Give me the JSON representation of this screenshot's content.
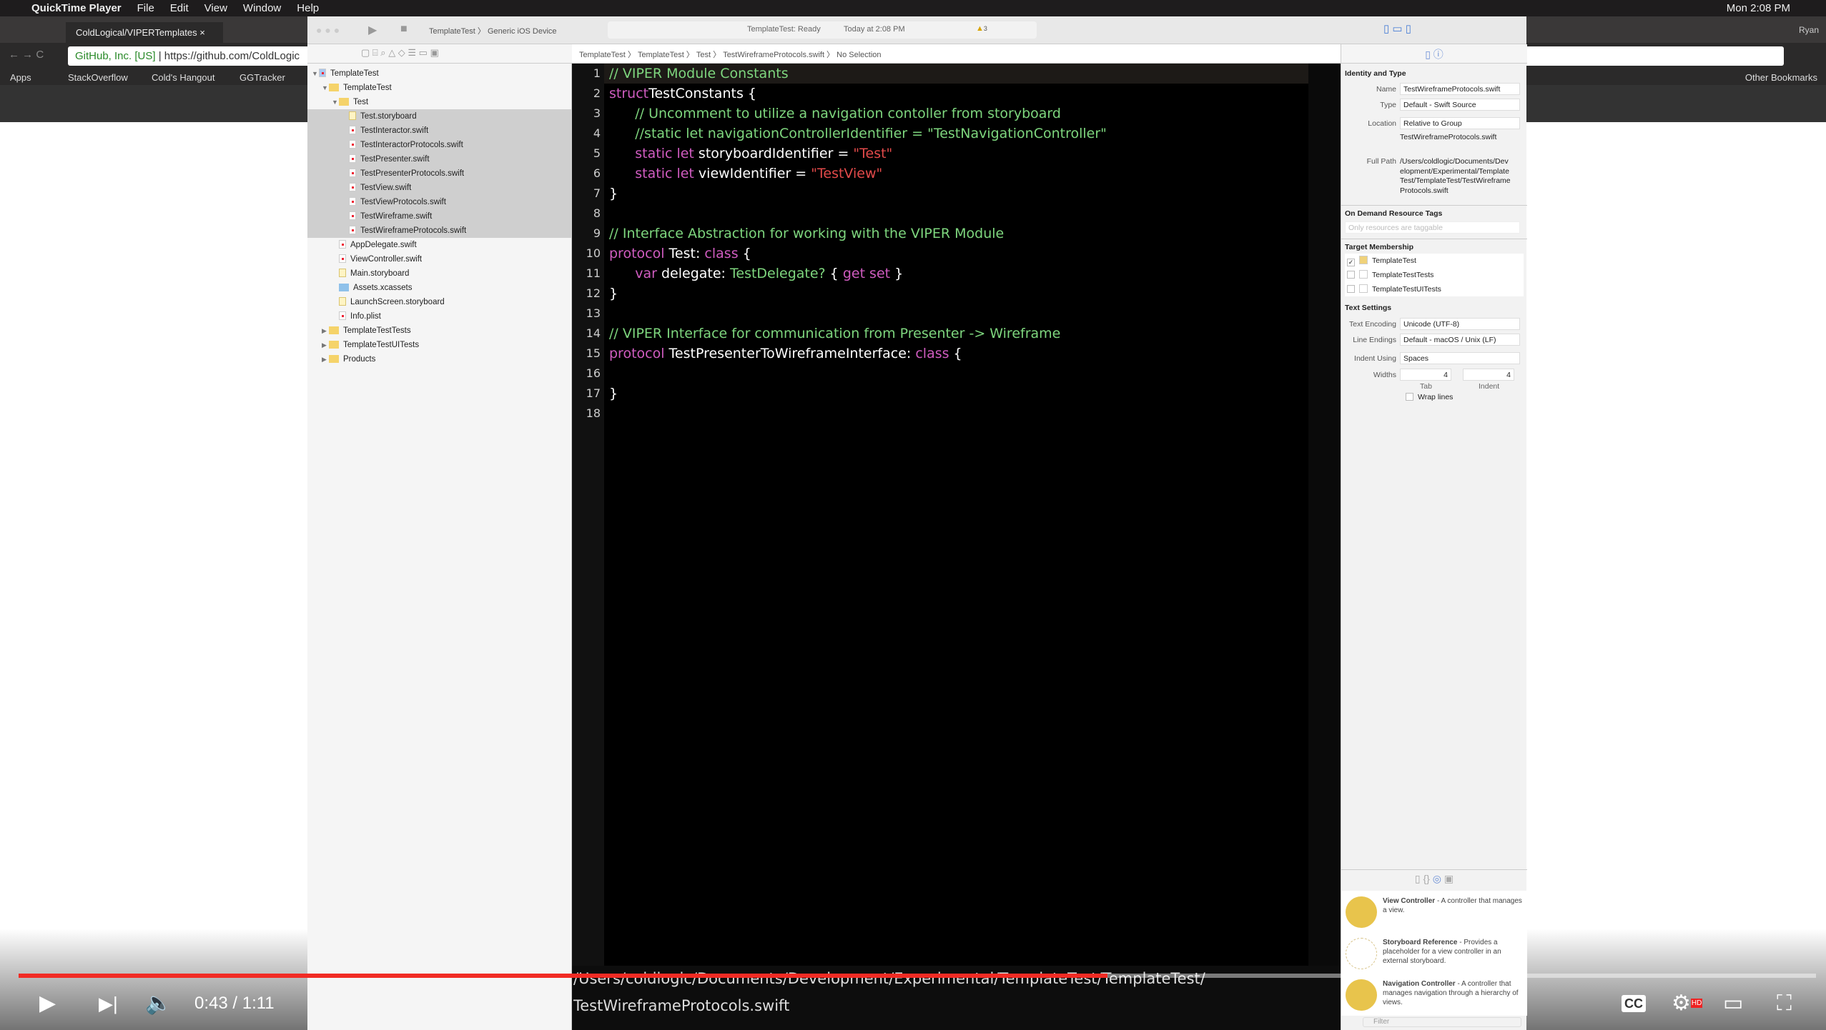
{
  "menubar": {
    "app": "QuickTime Player",
    "items": [
      "File",
      "Edit",
      "View",
      "Window",
      "Help"
    ],
    "clock": "Mon 2:08 PM"
  },
  "chrome": {
    "tab_title": "ColdLogical/VIPERTemplates",
    "user": "Ryan",
    "address_secure": "GitHub, Inc. [US]",
    "address_url": "https://github.com/ColdLogic",
    "bookmarks": [
      "Apps",
      "StackOverflow",
      "Cold's Hangout",
      "GGTracker"
    ],
    "other_bookmarks": "Other Bookmarks"
  },
  "xcode": {
    "scheme": "TemplateTest",
    "device": "Generic iOS Device",
    "status": "TemplateTest: Ready",
    "status_time": "Today at 2:08 PM",
    "warning_count": "3",
    "jumpbar": [
      "TemplateTest",
      "TemplateTest",
      "Test",
      "TestWireframeProtocols.swift",
      "No Selection"
    ],
    "navigator": [
      {
        "label": "TemplateTest",
        "level": 0,
        "kind": "project",
        "open": true
      },
      {
        "label": "TemplateTest",
        "level": 1,
        "kind": "folder",
        "open": true
      },
      {
        "label": "Test",
        "level": 2,
        "kind": "folder",
        "open": true
      },
      {
        "label": "Test.storyboard",
        "level": 3,
        "kind": "storyboard",
        "selected": true
      },
      {
        "label": "TestInteractor.swift",
        "level": 3,
        "kind": "swift",
        "selected": true
      },
      {
        "label": "TestInteractorProtocols.swift",
        "level": 3,
        "kind": "swift",
        "selected": true
      },
      {
        "label": "TestPresenter.swift",
        "level": 3,
        "kind": "swift",
        "selected": true
      },
      {
        "label": "TestPresenterProtocols.swift",
        "level": 3,
        "kind": "swift",
        "selected": true
      },
      {
        "label": "TestView.swift",
        "level": 3,
        "kind": "swift",
        "selected": true
      },
      {
        "label": "TestViewProtocols.swift",
        "level": 3,
        "kind": "swift",
        "selected": true
      },
      {
        "label": "TestWireframe.swift",
        "level": 3,
        "kind": "swift",
        "selected": true
      },
      {
        "label": "TestWireframeProtocols.swift",
        "level": 3,
        "kind": "swift",
        "selected": true
      },
      {
        "label": "AppDelegate.swift",
        "level": 2,
        "kind": "swift"
      },
      {
        "label": "ViewController.swift",
        "level": 2,
        "kind": "swift"
      },
      {
        "label": "Main.storyboard",
        "level": 2,
        "kind": "storyboard"
      },
      {
        "label": "Assets.xcassets",
        "level": 2,
        "kind": "assets"
      },
      {
        "label": "LaunchScreen.storyboard",
        "level": 2,
        "kind": "storyboard"
      },
      {
        "label": "Info.plist",
        "level": 2,
        "kind": "plist"
      },
      {
        "label": "TemplateTestTests",
        "level": 1,
        "kind": "folder",
        "open": false
      },
      {
        "label": "TemplateTestUITests",
        "level": 1,
        "kind": "folder",
        "open": false
      },
      {
        "label": "Products",
        "level": 1,
        "kind": "folder",
        "open": false
      }
    ],
    "code": [
      [
        [
          "cm",
          "// VIPER Module Constants"
        ]
      ],
      [
        [
          "kw",
          "struct"
        ],
        [
          "",
          "TestConstants {"
        ]
      ],
      [
        [
          "",
          "      "
        ],
        [
          "cm",
          "// Uncomment to utilize a navigation contoller from storyboard"
        ]
      ],
      [
        [
          "",
          "      "
        ],
        [
          "cm",
          "//static let navigationControllerIdentifier = \"TestNavigationController\""
        ]
      ],
      [
        [
          "",
          "      "
        ],
        [
          "kw",
          "static let"
        ],
        [
          "",
          " storyboardIdentifier = "
        ],
        [
          "st",
          "\"Test\""
        ]
      ],
      [
        [
          "",
          "      "
        ],
        [
          "kw",
          "static let"
        ],
        [
          "",
          " viewIdentifier = "
        ],
        [
          "st",
          "\"TestView\""
        ]
      ],
      [
        [
          "",
          "}"
        ]
      ],
      [],
      [
        [
          "cm",
          "// Interface Abstraction for working with the VIPER Module"
        ]
      ],
      [
        [
          "kw",
          "protocol"
        ],
        [
          "",
          " Test: "
        ],
        [
          "kw",
          "class"
        ],
        [
          "",
          " {"
        ]
      ],
      [
        [
          "",
          "      "
        ],
        [
          "kw",
          "var"
        ],
        [
          "",
          " delegate: "
        ],
        [
          "ty",
          "TestDelegate?"
        ],
        [
          "",
          " { "
        ],
        [
          "kw",
          "get set"
        ],
        [
          "",
          " }"
        ]
      ],
      [
        [
          "",
          "}"
        ]
      ],
      [],
      [
        [
          "cm",
          "// VIPER Interface for communication from Presenter -> Wireframe"
        ]
      ],
      [
        [
          "kw",
          "protocol"
        ],
        [
          "",
          " TestPresenterToWireframeInterface: "
        ],
        [
          "kw",
          "class"
        ],
        [
          "",
          " {"
        ]
      ],
      [],
      [
        [
          "",
          "}"
        ]
      ],
      []
    ],
    "debug_path_1": "/Users/coldlogic/Documents/Development/Experimental/TemplateTest/TemplateTest/",
    "debug_path_2": "TestWireframeProtocols.swift",
    "inspector": {
      "identity_header": "Identity and Type",
      "name_label": "Name",
      "name": "TestWireframeProtocols.swift",
      "type_label": "Type",
      "type": "Default - Swift Source",
      "location_label": "Location",
      "location": "Relative to Group",
      "relative_path": "TestWireframeProtocols.swift",
      "full_path_label": "Full Path",
      "full_path": "/Users/coldlogic/Documents/Development/Experimental/TemplateTest/TemplateTest/TestWireframeProtocols.swift",
      "odr_header": "On Demand Resource Tags",
      "odr_placeholder": "Only resources are taggable",
      "target_header": "Target Membership",
      "targets": [
        {
          "label": "TemplateTest",
          "checked": true
        },
        {
          "label": "TemplateTestTests",
          "checked": false
        },
        {
          "label": "TemplateTestUITests",
          "checked": false
        }
      ],
      "text_header": "Text Settings",
      "encoding_label": "Text Encoding",
      "encoding": "Unicode (UTF-8)",
      "endings_label": "Line Endings",
      "endings": "Default - macOS / Unix (LF)",
      "indent_label": "Indent Using",
      "indent": "Spaces",
      "widths_label": "Widths",
      "tab_width": "4",
      "indent_width": "4",
      "tab_label": "Tab",
      "indent_sub_label": "Indent",
      "wrap_label": "Wrap lines",
      "library": [
        {
          "title": "View Controller",
          "desc": " - A controller that manages a view."
        },
        {
          "title": "Storyboard Reference",
          "desc": " - Provides a placeholder for a view controller in an external storyboard."
        },
        {
          "title": "Navigation Controller",
          "desc": " - A controller that manages navigation through a hierarchy of views."
        }
      ],
      "filter_placeholder": "Filter"
    }
  },
  "player": {
    "time": "0:43 / 1:11",
    "progress": 0.606,
    "accent": "#f12b24"
  }
}
